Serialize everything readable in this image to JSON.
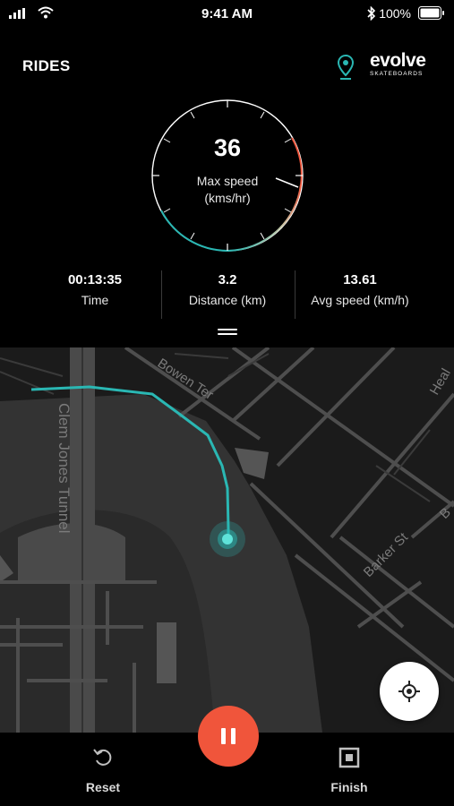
{
  "status_bar": {
    "time": "9:41 AM",
    "battery": "100%"
  },
  "header": {
    "title": "RIDES",
    "brand": "evolve",
    "brand_sub": "SKATEBOARDS"
  },
  "gauge": {
    "value": "36",
    "label_line1": "Max speed",
    "label_line2": "(kms/hr)"
  },
  "stats": [
    {
      "value": "00:13:35",
      "label": "Time"
    },
    {
      "value": "3.2",
      "label": "Distance (km)"
    },
    {
      "value": "13.61",
      "label": "Avg speed (km/h)"
    }
  ],
  "map": {
    "street_labels": [
      "Clem Jones Tunnel",
      "Bowen Ter",
      "Barker St",
      "Heal",
      "B"
    ],
    "route_color": "#2ab7b3"
  },
  "bottom_bar": {
    "reset_label": "Reset",
    "finish_label": "Finish",
    "pause_color": "#f0553b"
  }
}
